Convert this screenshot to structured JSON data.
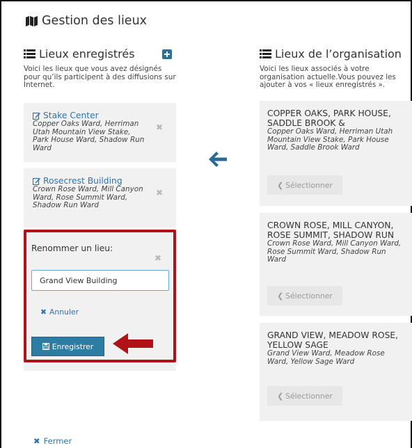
{
  "page": {
    "title": "Gestion des lieux"
  },
  "saved": {
    "heading": "Lieux enregistrés",
    "description": "Voici les lieux que vous avez désignés pour qu’ils participent à des diffusions sur Internet.",
    "items": [
      {
        "name": "Stake Center",
        "wards": "Copper Oaks Ward, Herriman Utah Mountain View Stake, Park House Ward, Shadow Run Ward"
      },
      {
        "name": "Rosecrest Building",
        "wards": "Crown Rose Ward, Mill Canyon Ward, Rose Summit Ward, Shadow Run Ward"
      }
    ],
    "rename": {
      "label": "Renommer un lieu:",
      "value": "Grand View Building",
      "cancel_label": "Annuler",
      "save_label": "Enregistrer"
    }
  },
  "org": {
    "heading": "Lieux de l’organisation",
    "description": "Voici les lieux associés à votre organisation actuelle.Vous pouvez les ajouter à vos « lieux enregistrés ».",
    "items": [
      {
        "title": "COPPER OAKS, PARK HOUSE, SADDLE BROOK &",
        "wards": "Copper Oaks Ward, Herriman Utah Mountain View Stake, Park House Ward, Saddle Brook Ward",
        "select_label": "Sélectionner"
      },
      {
        "title": "CROWN ROSE, MILL CANYON, ROSE SUMMIT, SHADOW RUN",
        "wards": "Crown Rose Ward, Mill Canyon Ward, Rose Summit Ward, Shadow Run Ward",
        "select_label": "Sélectionner"
      },
      {
        "title": "GRAND VIEW, MEADOW ROSE, YELLOW SAGE",
        "wards": "Grand View Ward, Meadow Rose Ward, Yellow Sage Ward",
        "select_label": "Sélectionner"
      }
    ]
  },
  "footer": {
    "close_label": "Fermer"
  },
  "colors": {
    "link": "#2f74b1",
    "primary_button": "#2c7ca4",
    "highlight_border": "#b11217",
    "card_bg": "#f1f1f1"
  },
  "icons": [
    "map-icon",
    "list-icon",
    "plus-icon",
    "edit-icon",
    "close-icon",
    "save-icon",
    "chevron-left-icon",
    "arrow-left-icon"
  ]
}
